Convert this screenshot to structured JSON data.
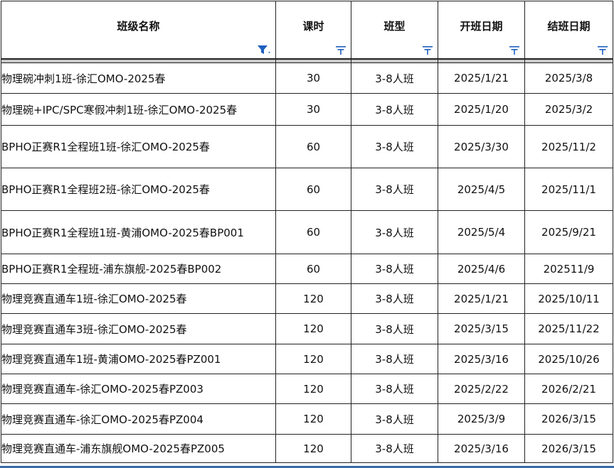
{
  "columns": [
    {
      "label": "班级名称",
      "filter_state": "active"
    },
    {
      "label": "课时",
      "filter_state": "inactive"
    },
    {
      "label": "班型",
      "filter_state": "inactive"
    },
    {
      "label": "开班日期",
      "filter_state": "inactive"
    },
    {
      "label": "结班日期",
      "filter_state": "inactive"
    }
  ],
  "colors": {
    "filter_icon": "#1f5fbf",
    "grid": "#222222",
    "separator": "#c8c8c8",
    "bottom_bar": "#3b6aa8"
  },
  "rows": [
    {
      "name": "物理碗冲刺1班-徐汇OMO-2025春",
      "hours": "30",
      "type": "3-8人班",
      "start": "2025/1/21",
      "end": "2025/3/8"
    },
    {
      "name": "物理碗+IPC/SPC寒假冲刺1班-徐汇OMO-2025春",
      "hours": "30",
      "type": "3-8人班",
      "start": "2025/1/20",
      "end": "2025/3/2"
    },
    {
      "name": "BPHO正赛R1全程班1班-徐汇OMO-2025春",
      "hours": "60",
      "type": "3-8人班",
      "start": "2025/3/30",
      "end": "2025/11/2"
    },
    {
      "name": "BPHO正赛R1全程班2班-徐汇OMO-2025春",
      "hours": "60",
      "type": "3-8人班",
      "start": "2025/4/5",
      "end": "2025/11/1"
    },
    {
      "name": "BPHO正赛R1全程班1班-黄浦OMO-2025春BP001",
      "hours": "60",
      "type": "3-8人班",
      "start": "2025/5/4",
      "end": "2025/9/21"
    },
    {
      "name": "BPHO正赛R1全程班-浦东旗舰-2025春BP002",
      "hours": "60",
      "type": "3-8人班",
      "start": "2025/4/6",
      "end": "202511/9"
    },
    {
      "name": "物理竞赛直通车1班-徐汇OMO-2025春",
      "hours": "120",
      "type": "3-8人班",
      "start": "2025/1/21",
      "end": "2025/10/11"
    },
    {
      "name": "物理竞赛直通车3班-徐汇OMO-2025春",
      "hours": "120",
      "type": "3-8人班",
      "start": "2025/3/15",
      "end": "2025/11/22"
    },
    {
      "name": "物理竞赛直通车1班-黄浦OMO-2025春PZ001",
      "hours": "120",
      "type": "3-8人班",
      "start": "2025/3/16",
      "end": "2025/10/26"
    },
    {
      "name": "物理竞赛直通车-徐汇OMO-2025春PZ003",
      "hours": "120",
      "type": "3-8人班",
      "start": "2025/2/22",
      "end": "2026/2/21"
    },
    {
      "name": "物理竞赛直通车-徐汇OMO-2025春PZ004",
      "hours": "120",
      "type": "3-8人班",
      "start": "2025/3/9",
      "end": "2026/3/15"
    },
    {
      "name": "物理竞赛直通车-浦东旗舰OMO-2025春PZ005",
      "hours": "120",
      "type": "3-8人班",
      "start": "2025/3/16",
      "end": "2026/3/15"
    }
  ]
}
